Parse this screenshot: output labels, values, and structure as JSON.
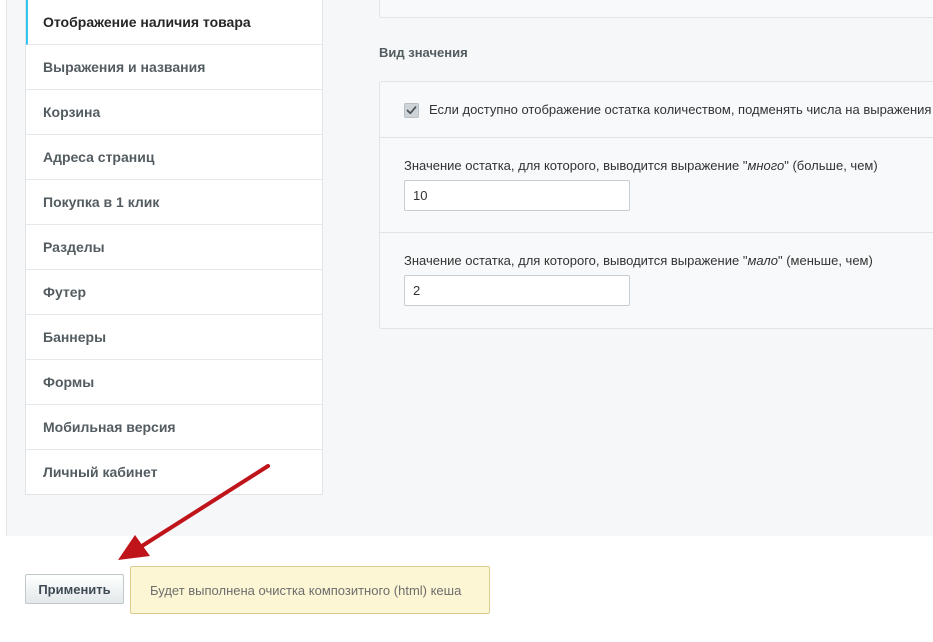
{
  "sidebar": {
    "items": [
      {
        "label": "Отображение наличия товара",
        "active": true
      },
      {
        "label": "Выражения и названия"
      },
      {
        "label": "Корзина"
      },
      {
        "label": "Адреса страниц"
      },
      {
        "label": "Покупка в 1 клик"
      },
      {
        "label": "Разделы"
      },
      {
        "label": "Футер"
      },
      {
        "label": "Баннеры"
      },
      {
        "label": "Формы"
      },
      {
        "label": "Мобильная версия"
      },
      {
        "label": "Личный кабинет"
      }
    ]
  },
  "section": {
    "title": "Вид значения",
    "checkbox": {
      "label": "Если доступно отображение остатка количеством, подменять числа на выражения",
      "checked": true
    },
    "fields": [
      {
        "label_prefix": "Значение остатка, для которого, выводится выражение \"",
        "label_word": "много",
        "label_suffix": "\" (больше, чем)",
        "value": "10"
      },
      {
        "label_prefix": "Значение остатка, для которого, выводится выражение \"",
        "label_word": "мало",
        "label_suffix": "\" (меньше, чем)",
        "value": "2"
      }
    ]
  },
  "footer": {
    "apply_label": "Применить",
    "notice_text": "Будет выполнена очистка композитного (html) кеша"
  },
  "colors": {
    "arrow": "#c0141b",
    "active_accent": "#2fc6f6",
    "notice_bg": "#fdf6d4"
  }
}
